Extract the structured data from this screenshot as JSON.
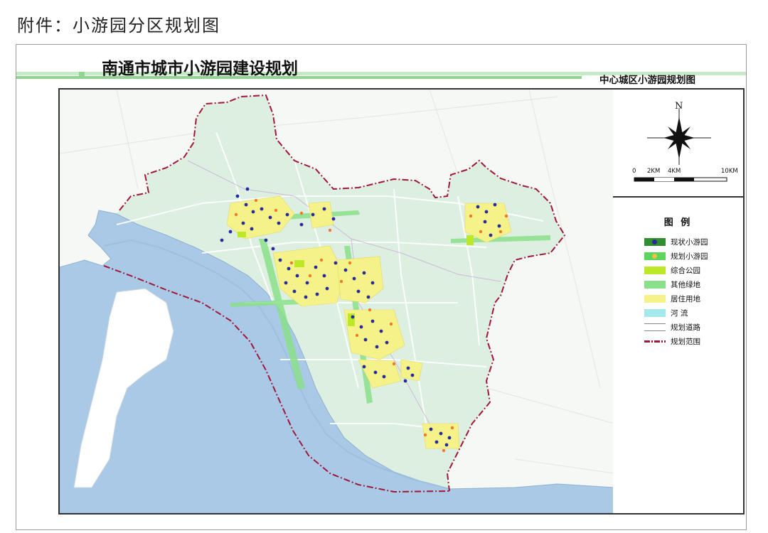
{
  "page": {
    "caption": "附件：小游园分区规划图"
  },
  "map": {
    "title": "南通市城市小游园建设规划",
    "subtitle": "中心城区小游园规划图",
    "compass_north": "N",
    "scale_labels": [
      "0",
      "2KM",
      "4KM",
      "10KM"
    ],
    "legend_title": "图  例",
    "legend": [
      {
        "label": "现状小游园",
        "swatch": "existing-park",
        "color": "#2f8f2f"
      },
      {
        "label": "规划小游园",
        "swatch": "planned-park",
        "color": "#5bd65b"
      },
      {
        "label": "综合公园",
        "swatch": "comprehensive-park",
        "color": "#bde82a"
      },
      {
        "label": "其他绿地",
        "swatch": "other-green",
        "color": "#8ae08a"
      },
      {
        "label": "居住用地",
        "swatch": "residential",
        "color": "#f5f28a"
      },
      {
        "label": "河  流",
        "swatch": "river",
        "color": "#a5e8ec"
      },
      {
        "label": "规划道路",
        "swatch": "road",
        "color": "#ffffff"
      },
      {
        "label": "规划范围",
        "swatch": "boundary",
        "color": "#a01838"
      }
    ],
    "colors": {
      "river_water": "#a9c9e6",
      "urban_base": "#dceee1",
      "boundary_line": "#a01838",
      "existing_marker": "#2a2a9a",
      "planned_marker": "#f07a2a"
    }
  }
}
